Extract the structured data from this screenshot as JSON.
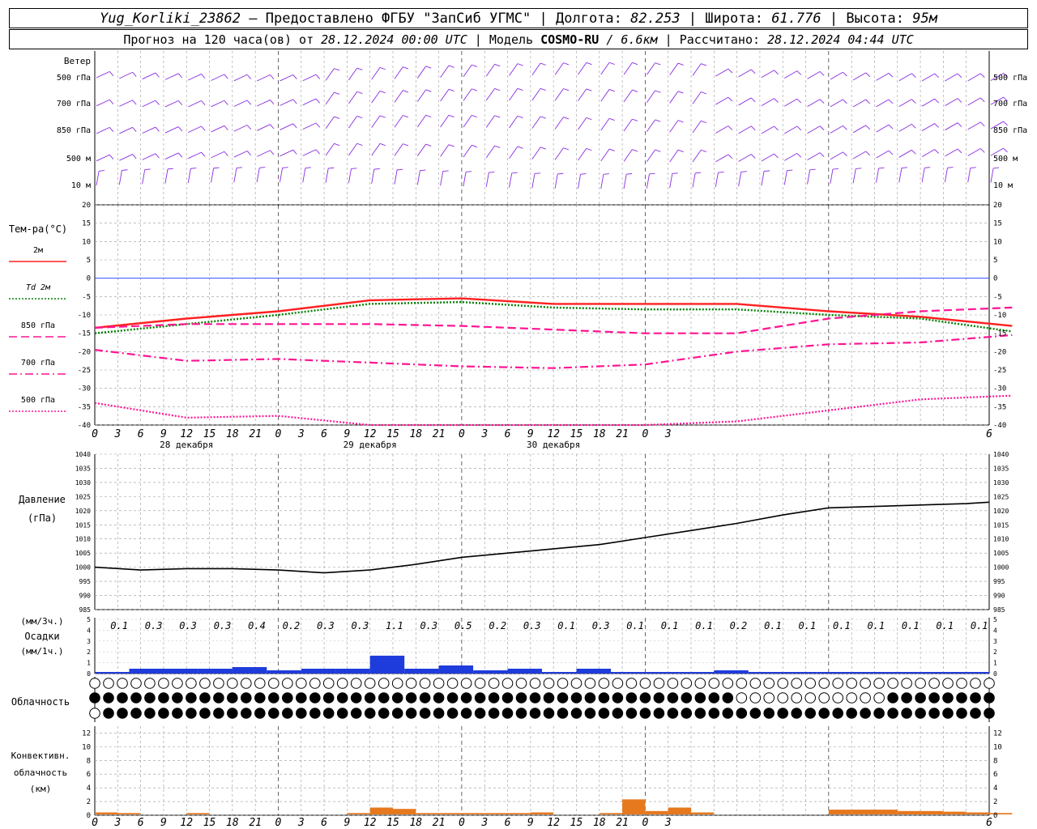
{
  "header": {
    "station": "Yug_Korliki_23862",
    "provider": "– Предоставлено ФГБУ \"ЗапСиб УГМС\"",
    "lon_label": "Долгота:",
    "lon": "82.253",
    "lat_label": "Широта:",
    "lat": "61.776",
    "alt_label": "Высота:",
    "alt": "95м",
    "forecast_label": "Прогноз на 120 часа(ов) от",
    "forecast_start": "28.12.2024 00:00 UTC",
    "model_label": "Модель",
    "model": "COSMO-RU",
    "resolution": "/ 6.6км",
    "computed_label": "Рассчитано:",
    "computed": "28.12.2024 04:44 UTC"
  },
  "wind_panel": {
    "title": "Ветер",
    "levels": [
      "500 гПа",
      "700 гПа",
      "850 гПа",
      "500 м",
      "10  м"
    ],
    "color": "#8a2be2"
  },
  "temp_panel": {
    "title": "Тем-ра(°С)",
    "legend": [
      {
        "label": "2м",
        "color": "#ff2020",
        "style": "solid"
      },
      {
        "label": "Td  2м",
        "color": "#008000",
        "style": "dotted"
      },
      {
        "label": "850 гПа",
        "color": "#ff1493",
        "style": "dash"
      },
      {
        "label": "700 гПа",
        "color": "#ff1493",
        "style": "dashdot"
      },
      {
        "label": "500 гПа",
        "color": "#ff1493",
        "style": "dotted"
      }
    ],
    "ylim": [
      -40,
      20
    ],
    "yticks": [
      "20",
      "15",
      "10",
      "5",
      "0",
      "-5",
      "-10",
      "-15",
      "-20",
      "-25",
      "-30",
      "-35",
      "-40"
    ]
  },
  "time_axis": {
    "hour_labels": [
      "0",
      "3",
      "6",
      "9",
      "12",
      "15",
      "18",
      "21",
      "0",
      "3",
      "6",
      "9",
      "12",
      "15",
      "18",
      "21",
      "0",
      "3",
      "6",
      "9",
      "12",
      "15",
      "18",
      "21",
      "0",
      "3",
      "6"
    ],
    "day_labels": [
      "28 декабря",
      "29 декабря",
      "30 декабря"
    ]
  },
  "pressure_panel": {
    "title": "Давление",
    "unit": "(гПа)",
    "ylim": [
      985,
      1040
    ],
    "yticks": [
      "1040",
      "1035",
      "1030",
      "1025",
      "1020",
      "1015",
      "1010",
      "1005",
      "1000",
      "995",
      "990",
      "985"
    ]
  },
  "precip_panel": {
    "unit_top": "(мм/3ч.)",
    "title": "Осадки",
    "unit_bottom": "(мм/1ч.)",
    "yticks": [
      "5",
      "4",
      "3",
      "2",
      "1",
      "0"
    ],
    "three_hour_totals": [
      "0.1",
      "0.3",
      "0.3",
      "0.3",
      "0.4",
      "0.2",
      "0.3",
      "0.3",
      "1.1",
      "0.3",
      "0.5",
      "0.2",
      "0.3",
      "0.1",
      "0.3",
      "0.1",
      "0.1",
      "0.1",
      "0.2",
      "0.1",
      "0.1",
      "0.1",
      "0.1",
      "0.1",
      "0.1",
      "0.1"
    ],
    "color": "#1e3cdc"
  },
  "cloud_panel": {
    "title": "Облачность"
  },
  "conv_panel": {
    "title_line1": "Конвективн.",
    "title_line2": "облачность",
    "unit": "(км)",
    "yticks": [
      "12",
      "10",
      "8",
      "6",
      "4",
      "2",
      "0"
    ],
    "color": "#e6781e"
  },
  "chart_data": [
    {
      "type": "line",
      "title": "Тем-ра(°С)",
      "x_hours": [
        0,
        12,
        24,
        36,
        48,
        60,
        72,
        84,
        96,
        108,
        120
      ],
      "ylim": [
        -40,
        20
      ],
      "series": [
        {
          "name": "2м",
          "values": [
            -13.5,
            -11,
            -9,
            -6,
            -5.5,
            -7,
            -7,
            -7,
            -9,
            -10.5,
            -13
          ]
        },
        {
          "name": "Td  2м",
          "values": [
            -15,
            -12.5,
            -10,
            -7,
            -6.5,
            -8,
            -8.5,
            -8.5,
            -10,
            -11,
            -14.5
          ]
        },
        {
          "name": "850 гПа",
          "values": [
            -13.5,
            -12.5,
            -12.5,
            -12.5,
            -13,
            -14,
            -15,
            -15,
            -11,
            -9,
            -8
          ]
        },
        {
          "name": "700 гПа",
          "values": [
            -19.5,
            -22.5,
            -22,
            -23,
            -24,
            -24.5,
            -23.5,
            -20,
            -18,
            -17.5,
            -15.5
          ]
        },
        {
          "name": "500 гПа",
          "values": [
            -34,
            -38,
            -37.5,
            -40,
            -40,
            -40,
            -40,
            -39,
            -36,
            -33,
            -32
          ]
        }
      ]
    },
    {
      "type": "line",
      "title": "Давление",
      "x_hours": [
        0,
        6,
        12,
        18,
        24,
        30,
        36,
        42,
        48,
        54,
        60,
        66,
        72,
        78,
        84,
        90,
        96,
        102,
        108,
        114,
        120
      ],
      "ylim": [
        985,
        1040
      ],
      "series": [
        {
          "name": "",
          "values": [
            1000,
            999,
            999.5,
            999.5,
            999,
            998,
            999,
            1001,
            1003.5,
            1005,
            1006.5,
            1008,
            1010.5,
            1013,
            1015.5,
            1018.5,
            1021,
            1021.5,
            1022,
            1022.5,
            1023
          ]
        }
      ]
    },
    {
      "type": "bar",
      "title": "Осадки",
      "categories": [
        "0",
        "3",
        "6",
        "9",
        "12",
        "15",
        "18",
        "21",
        "0",
        "3",
        "6",
        "9",
        "12",
        "15",
        "18",
        "21",
        "0",
        "3",
        "6",
        "9",
        "12",
        "15",
        "18",
        "21",
        "0",
        "3"
      ],
      "values": [
        0.1,
        0.3,
        0.3,
        0.3,
        0.4,
        0.2,
        0.3,
        0.3,
        1.1,
        0.3,
        0.5,
        0.2,
        0.3,
        0.1,
        0.3,
        0.1,
        0.1,
        0.1,
        0.2,
        0.1,
        0.1,
        0.1,
        0.1,
        0.1,
        0.1,
        0.1
      ]
    },
    {
      "type": "bar",
      "title": "Конвективн. облачность",
      "x_hours": [
        0,
        3,
        6,
        9,
        12,
        15,
        18,
        21,
        24,
        27,
        30,
        33,
        36,
        39,
        42,
        45,
        48,
        51,
        54,
        57,
        60,
        63,
        66,
        69,
        72,
        75,
        78,
        81,
        84,
        87,
        90,
        93,
        96,
        99,
        102,
        105,
        108,
        111,
        114,
        117
      ],
      "values": [
        0.3,
        0.2,
        0,
        0,
        0.2,
        0,
        0,
        0,
        0,
        0,
        0,
        0.2,
        1.0,
        0.8,
        0.2,
        0.2,
        0.2,
        0.2,
        0.2,
        0.3,
        0,
        0,
        0.2,
        2.2,
        0.5,
        1.0,
        0.3,
        0,
        0,
        0,
        0,
        0,
        0.7,
        0.7,
        0.7,
        0.5,
        0.5,
        0.4,
        0.3,
        0.2
      ],
      "ylim": [
        0,
        13
      ]
    }
  ]
}
